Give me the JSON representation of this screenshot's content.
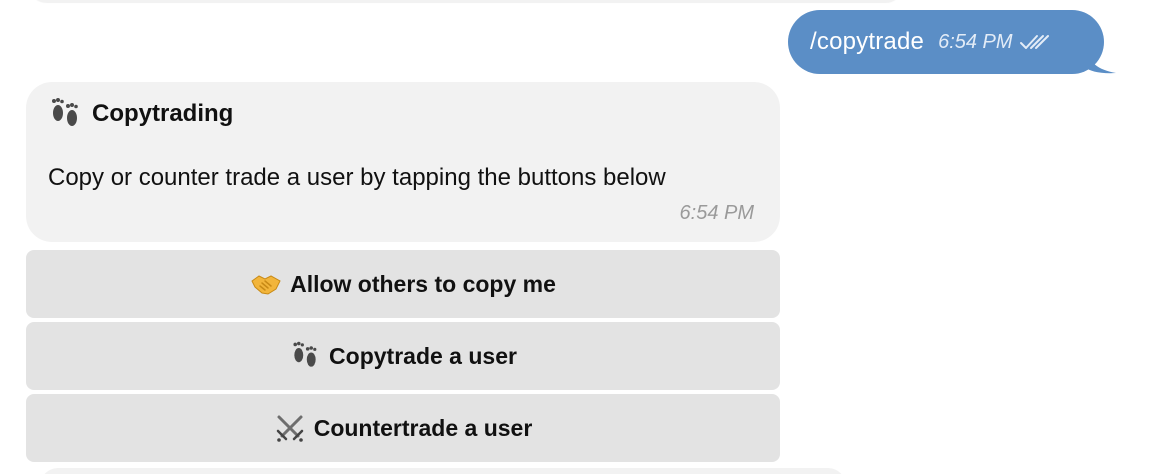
{
  "outgoing_message": {
    "text": "/copytrade",
    "time": "6:54 PM",
    "status_icon": "double-check-icon",
    "bubble_color": "#5b8ec6"
  },
  "incoming_message": {
    "title_icon": "footprints-icon",
    "title": "Copytrading",
    "body": "Copy or counter trade a user by tapping the buttons below",
    "time": "6:54 PM",
    "bubble_color": "#f2f2f2"
  },
  "inline_keyboard": [
    {
      "icon": "handshake-icon",
      "label": "Allow others to copy me"
    },
    {
      "icon": "footprints-icon",
      "label": "Copytrade a user"
    },
    {
      "icon": "crossed-swords-icon",
      "label": "Countertrade a user"
    }
  ],
  "colors": {
    "button_bg": "#e3e3e3",
    "handshake": "#f2b53b"
  }
}
